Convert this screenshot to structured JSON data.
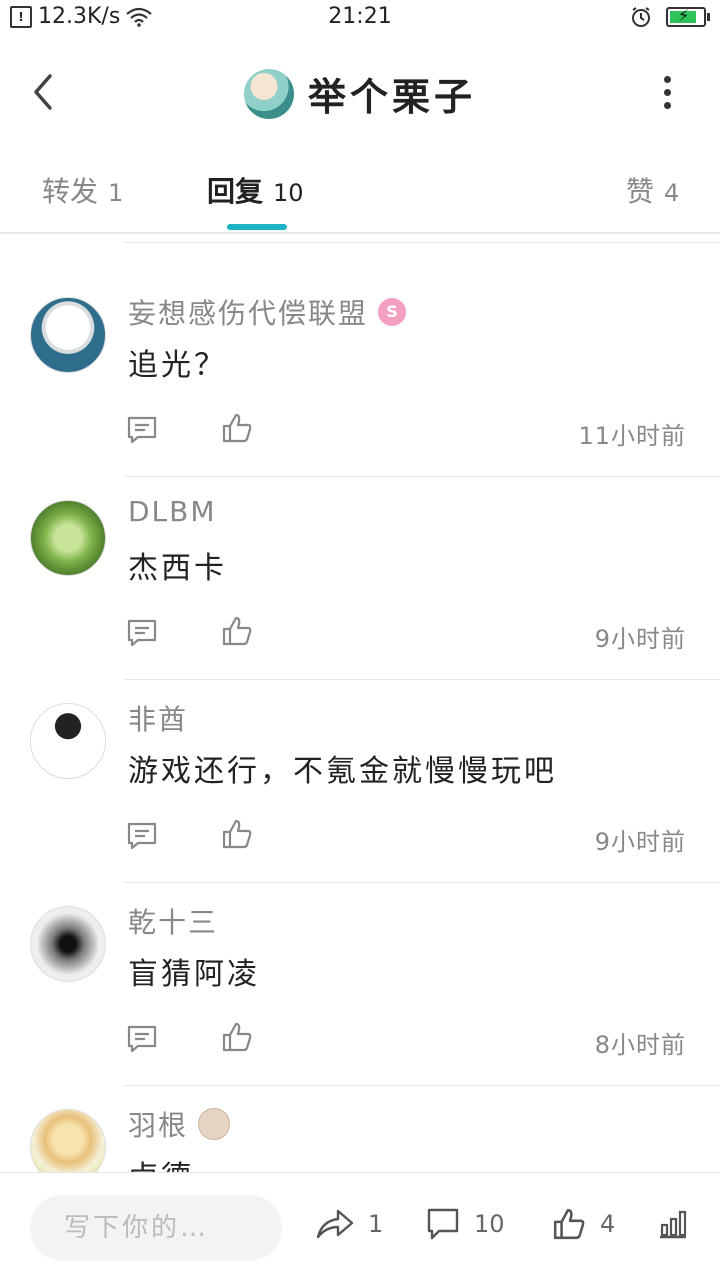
{
  "status_bar": {
    "speed": "12.3K/s",
    "time": "21:21"
  },
  "header": {
    "title": "举个栗子"
  },
  "tabs": [
    {
      "label": "转发",
      "count": "1"
    },
    {
      "label": "回复",
      "count": "10"
    },
    {
      "label": "赞",
      "count": "4"
    }
  ],
  "comments": [
    {
      "name": "妄想感伤代偿联盟",
      "badge": "S",
      "text": "追光？",
      "time": "11小时前"
    },
    {
      "name": "DLBM",
      "text": "杰西卡",
      "time": "9小时前"
    },
    {
      "name": "非酋",
      "text": "游戏还行，不氪金就慢慢玩吧",
      "time": "9小时前"
    },
    {
      "name": "乾十三",
      "text": "盲猜阿凌",
      "time": "8小时前"
    },
    {
      "name": "羽根",
      "text": "卤德",
      "time": ""
    }
  ],
  "bottom_bar": {
    "input_placeholder": "写下你的…",
    "share_count": "1",
    "comment_count": "10",
    "like_count": "4"
  },
  "colors": {
    "accent": "#1fb3c6",
    "battery": "#2ec35a"
  }
}
